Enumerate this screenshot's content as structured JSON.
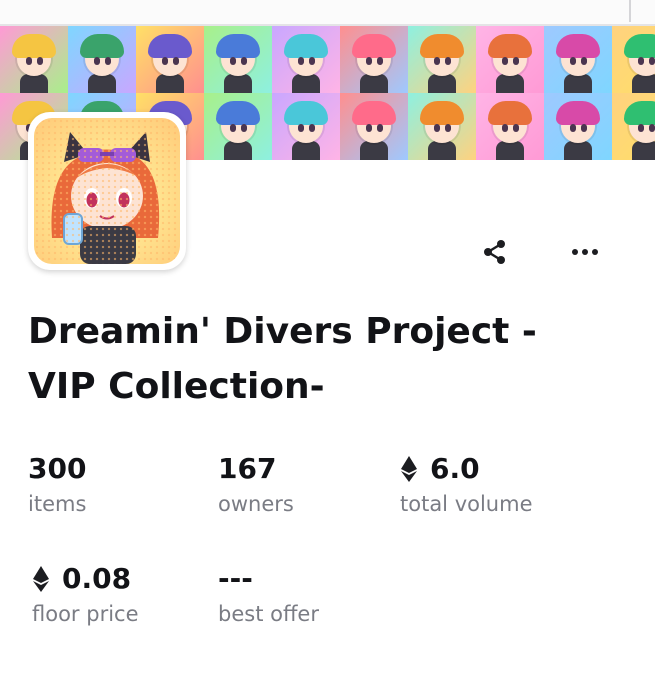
{
  "collection": {
    "title": "Dreamin' Divers Project -VIP Collection-",
    "title_line1": "Dreamin' Divers Project -",
    "title_line2": "VIP Collection-"
  },
  "actions": {
    "share_icon": "share-icon",
    "more_icon": "more-horizontal-icon"
  },
  "stats": [
    {
      "value": "300",
      "label": "items",
      "icon": ""
    },
    {
      "value": "167",
      "label": "owners",
      "icon": ""
    },
    {
      "value": "6.0",
      "label": "total volume",
      "icon": "ethereum-icon"
    },
    {
      "value": "0.08",
      "label": "floor price",
      "icon": "ethereum-icon"
    },
    {
      "value": "---",
      "label": "best offer",
      "icon": ""
    }
  ],
  "colors": {
    "text": "#121317",
    "muted": "#7a7c84",
    "banner_tiles": [
      "#ff9ad5",
      "#7fd6ff",
      "#ffe066",
      "#a8f08a",
      "#c9a7ff",
      "#ff8f8f",
      "#8ef0e0",
      "#ffb4e6",
      "#9ec9ff",
      "#ffd27f"
    ]
  }
}
